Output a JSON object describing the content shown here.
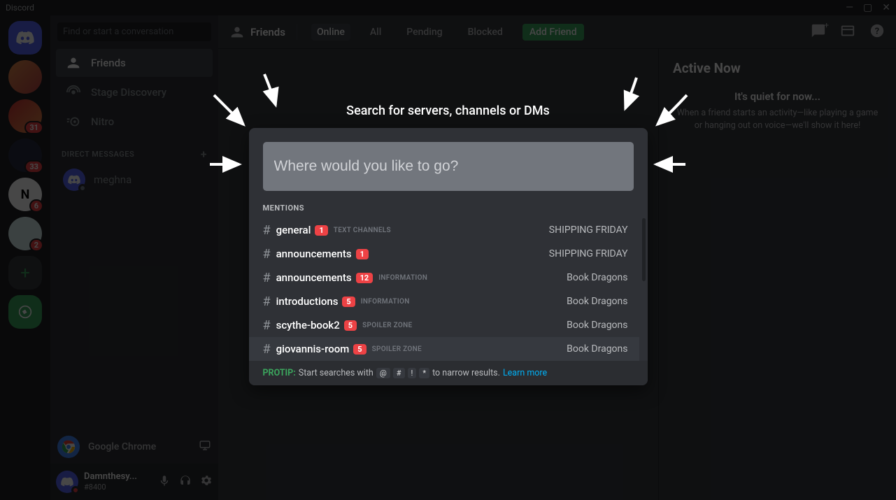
{
  "titlebar": {
    "app": "Discord"
  },
  "sidebar": {
    "search_placeholder": "Find or start a conversation",
    "items": [
      {
        "label": "Friends"
      },
      {
        "label": "Stage Discovery"
      },
      {
        "label": "Nitro"
      }
    ],
    "dm_header": "DIRECT MESSAGES",
    "dms": [
      {
        "name": "meghna"
      }
    ],
    "activity": {
      "label": "Google Chrome"
    },
    "user": {
      "name": "Damnthesy...",
      "tag": "#8400"
    }
  },
  "server_badges": [
    "31",
    "33",
    "6",
    "2"
  ],
  "tabs": {
    "friends": "Friends",
    "items": [
      "Online",
      "All",
      "Pending",
      "Blocked"
    ],
    "add": "Add Friend"
  },
  "active_now": {
    "title": "Active Now",
    "quiet": "It's quiet for now...",
    "quiet_sub": "When a friend starts an activity—like playing a game or hanging out on voice—we'll show it here!"
  },
  "search_modal": {
    "title": "Search for servers, channels or DMs",
    "placeholder": "Where would you like to go?",
    "section": "MENTIONS",
    "results": [
      {
        "channel": "general",
        "count": "1",
        "category": "TEXT CHANNELS",
        "server": "SHIPPING FRIDAY"
      },
      {
        "channel": "announcements",
        "count": "1",
        "category": "",
        "server": "SHIPPING FRIDAY"
      },
      {
        "channel": "announcements",
        "count": "12",
        "category": "INFORMATION",
        "server": "Book Dragons"
      },
      {
        "channel": "introductions",
        "count": "5",
        "category": "INFORMATION",
        "server": "Book Dragons"
      },
      {
        "channel": "scythe-book2",
        "count": "5",
        "category": "SPOILER ZONE",
        "server": "Book Dragons"
      },
      {
        "channel": "giovannis-room",
        "count": "5",
        "category": "SPOILER ZONE",
        "server": "Book Dragons"
      }
    ],
    "protip_label": "PROTIP:",
    "protip_text1": "Start searches with",
    "protip_keys": [
      "@",
      "#",
      "!",
      "*"
    ],
    "protip_text2": "to narrow results.",
    "protip_link": "Learn more"
  }
}
